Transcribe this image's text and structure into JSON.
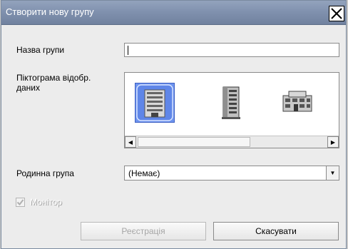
{
  "dialog": {
    "title": "Створити нову групу"
  },
  "group_name": {
    "label": "Назва групи",
    "value": ""
  },
  "icon_picker": {
    "label_line1": "Піктограма відобр.",
    "label_line2": "даних",
    "icons": [
      "building-tall-blue-icon",
      "building-tower-gray-icon",
      "building-low-gray-icon"
    ],
    "selected_index": 0
  },
  "parent_group": {
    "label": "Родинна група",
    "value": "(Немає)"
  },
  "monitor": {
    "label": "Монітор",
    "checked": true,
    "enabled": false
  },
  "buttons": {
    "register": "Реєстрація",
    "cancel": "Скасувати"
  },
  "colors": {
    "titlebar": "#7f90ad",
    "selection": "#6e94ef"
  }
}
